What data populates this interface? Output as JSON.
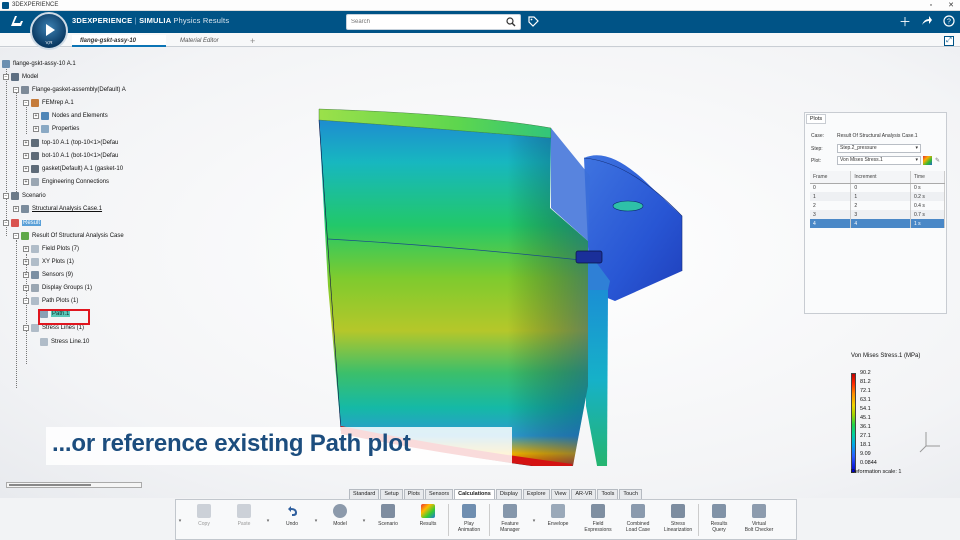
{
  "window": {
    "title": "3DEXPERIENCE",
    "controls": [
      "▫",
      "✕"
    ]
  },
  "header": {
    "brand": "3DEXPERIENCE",
    "separator": "|",
    "company": "SIMULIA",
    "app_name": "Physics Results",
    "compass_version": "V,R",
    "search_placeholder": "Search"
  },
  "tabs": [
    {
      "label": "flange-gskt-assy-10"
    },
    {
      "label": "Material Editor"
    }
  ],
  "tree": {
    "root": "flange-gskt-assy-10 A.1",
    "model": "Model",
    "assembly": "Flange-gasket-assembly(Default) A",
    "femrep": "FEMrep A.1",
    "nodes_elements": "Nodes and Elements",
    "properties": "Properties",
    "top": "top-10 A.1 (top-10<1>(Defau",
    "bot": "bot-10 A.1 (bot-10<1>(Defau",
    "gasket": "gasket(Default) A.1 (gasket-10",
    "eng_conn": "Engineering Connections",
    "scenario": "Scenario",
    "analysis_case": "Structural Analysis Case.1",
    "result": "Result",
    "result_of": "Result Of Structural Analysis Case",
    "field_plots": "Field Plots (7)",
    "xy_plots": "XY Plots (1)",
    "sensors": "Sensors (9)",
    "display_groups": "Display Groups (1)",
    "path_plots": "Path Plots (1)",
    "path1": "Path.1",
    "stress_lines": "Stress Lines (1)",
    "stress_line10": "Stress Line.10"
  },
  "plots_panel": {
    "tab": "Plots",
    "case_label": "Case:",
    "case_value": "Result Of Structural Analysis Case.1",
    "step_label": "Step:",
    "step_value": "Step.2_pressure",
    "plot_label": "Plot:",
    "plot_value": "Von Mises Stress.1",
    "columns": [
      "Frame",
      "Increment",
      "Time"
    ],
    "rows": [
      [
        "0",
        "0",
        "0 s"
      ],
      [
        "1",
        "1",
        "0.2 s"
      ],
      [
        "2",
        "2",
        "0.4 s"
      ],
      [
        "3",
        "3",
        "0.7 s"
      ],
      [
        "4",
        "4",
        "1 s"
      ]
    ],
    "selected_row": 4
  },
  "legend": {
    "title": "Von Mises Stress.1 (MPa)",
    "values": [
      "90.2",
      "81.2",
      "72.1",
      "63.1",
      "54.1",
      "45.1",
      "36.1",
      "27.1",
      "18.1",
      "9.09",
      "0.0844"
    ],
    "deformation": "Deformation scale: 1"
  },
  "caption": "...or reference existing Path plot",
  "action_tabs": [
    "Standard",
    "Setup",
    "Plots",
    "Sensors",
    "Calculations",
    "Display",
    "Explore",
    "View",
    "AR-VR",
    "Tools",
    "Touch"
  ],
  "active_action_tab": "Calculations",
  "tools": {
    "copy": "Copy",
    "paste": "Paste",
    "undo": "Undo",
    "model": "Model",
    "scenario": "Scenario",
    "results": "Results",
    "play1": "Play",
    "play2": "Animation",
    "fm1": "Feature",
    "fm2": "Manager",
    "envelope": "Envelope",
    "fe1": "Field",
    "fe2": "Expressions",
    "clc1": "Combined",
    "clc2": "Load Case",
    "sl1": "Stress",
    "sl2": "Linearization",
    "rq1": "Results",
    "rq2": "Query",
    "vb1": "Virtual",
    "vb2": "Bolt Checker"
  },
  "colors": {
    "brand_blue": "#005386",
    "highlight": "#e0161f",
    "caption": "#1c4d7e"
  }
}
